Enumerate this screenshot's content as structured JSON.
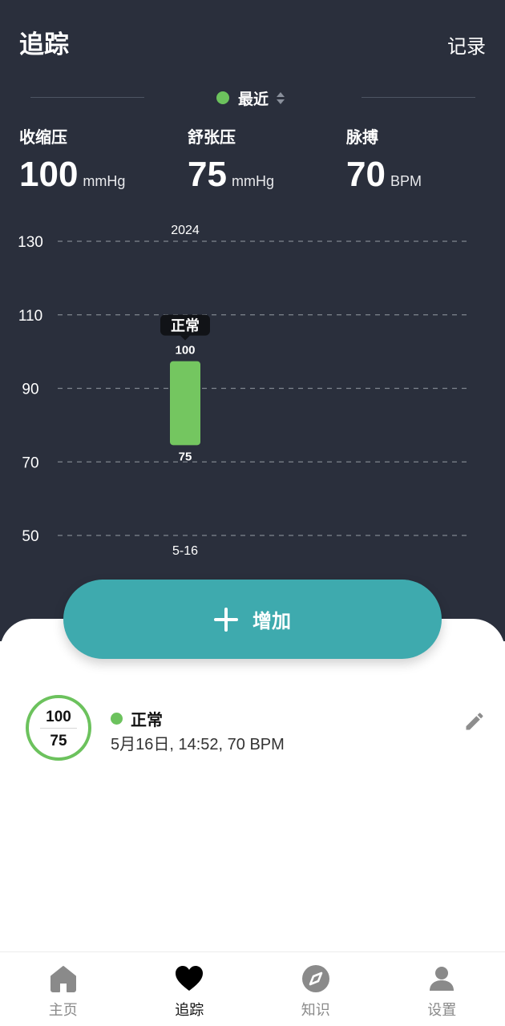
{
  "header": {
    "title": "追踪",
    "record_label": "记录"
  },
  "filter": {
    "label": "最近",
    "dot_color": "#6cc25d"
  },
  "stats": [
    {
      "name": "收缩压",
      "value": "100",
      "unit": "mmHg"
    },
    {
      "name": "舒张压",
      "value": "75",
      "unit": "mmHg"
    },
    {
      "name": "脉搏",
      "value": "70",
      "unit": "BPM"
    }
  ],
  "chart_data": {
    "type": "bar",
    "x_top_label": "2024",
    "categories": [
      "5-16"
    ],
    "ranges": [
      {
        "low": 75,
        "high": 100,
        "status": "正常"
      }
    ],
    "yticks": [
      130,
      110,
      90,
      70,
      50
    ],
    "ylim": [
      50,
      130
    ],
    "grid": "dashed",
    "bar_color": "#74c660"
  },
  "add_button": {
    "label": "增加"
  },
  "entries": [
    {
      "systolic": "100",
      "diastolic": "75",
      "status": "正常",
      "detail": "5月16日, 14:52, 70 BPM",
      "status_color": "#6cc25d"
    }
  ],
  "nav": [
    {
      "label": "主页",
      "icon": "home-icon",
      "active": false
    },
    {
      "label": "追踪",
      "icon": "heart-icon",
      "active": true
    },
    {
      "label": "知识",
      "icon": "compass-icon",
      "active": false
    },
    {
      "label": "设置",
      "icon": "user-icon",
      "active": false
    }
  ],
  "colors": {
    "header_bg": "#2a2f3c",
    "accent": "#3eaaae",
    "normal": "#6cc25d"
  }
}
